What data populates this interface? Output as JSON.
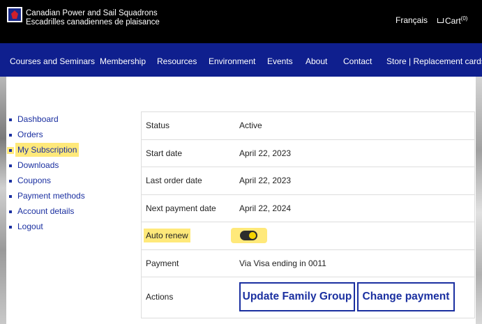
{
  "header": {
    "brand_line1": "Canadian Power and Sail Squadrons",
    "brand_line2": "Escadrilles canadiennes de plaisance",
    "language_link": "Français",
    "cart_label": "Cart",
    "cart_count": "(0)"
  },
  "nav": {
    "items": [
      "Courses and Seminars",
      "Membership",
      "Resources",
      "Environment",
      "Events",
      "About",
      "Contact",
      "Store | Replacement cards"
    ]
  },
  "sidebar": {
    "items": [
      "Dashboard",
      "Orders",
      "My Subscription",
      "Downloads",
      "Coupons",
      "Payment methods",
      "Account details",
      "Logout"
    ]
  },
  "subscription": {
    "status_label": "Status",
    "status_value": "Active",
    "start_label": "Start date",
    "start_value": "April 22, 2023",
    "last_order_label": "Last order date",
    "last_order_value": "April 22, 2023",
    "next_payment_label": "Next payment date",
    "next_payment_value": "April 22, 2024",
    "auto_renew_label": "Auto renew",
    "payment_label": "Payment",
    "payment_value": "Via Visa ending in 0011",
    "actions_label": "Actions",
    "update_family_button": "Update Family Group",
    "change_payment_button": "Change payment"
  },
  "colors": {
    "nav_background": "#0f1f8e",
    "link": "#1a2fa0",
    "highlight": "#ffe97a"
  }
}
